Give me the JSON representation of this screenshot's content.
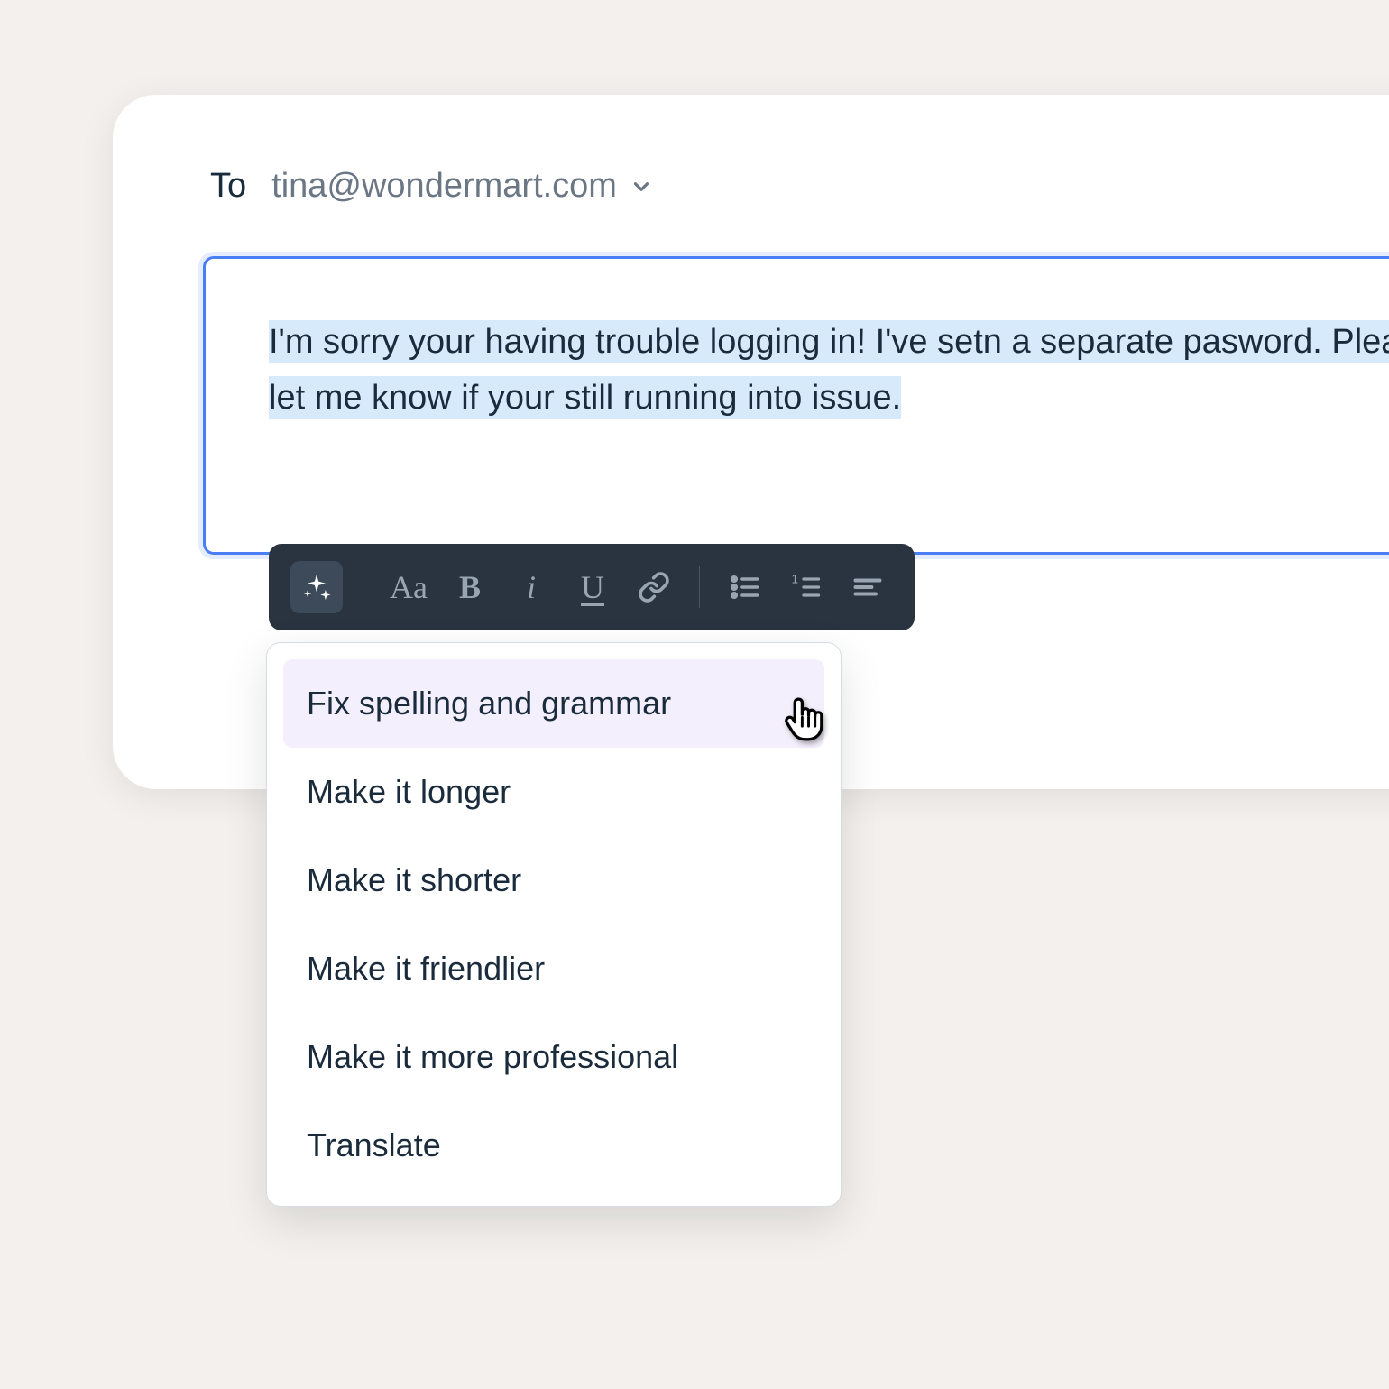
{
  "recipient": {
    "to_label": "To",
    "email": "tina@wondermart.com"
  },
  "editor": {
    "selected_text": "I'm sorry your having trouble logging in! I've setn a separate pasword. Please let me know if your still running into issue."
  },
  "toolbar": {
    "font_label": "Aa",
    "bold_label": "B",
    "italic_label": "i",
    "underline_label": "U"
  },
  "ai_menu": {
    "items": [
      "Fix spelling and grammar",
      "Make it longer",
      "Make it shorter",
      "Make it friendlier",
      "Make it more professional",
      "Translate"
    ],
    "highlighted_index": 0
  }
}
